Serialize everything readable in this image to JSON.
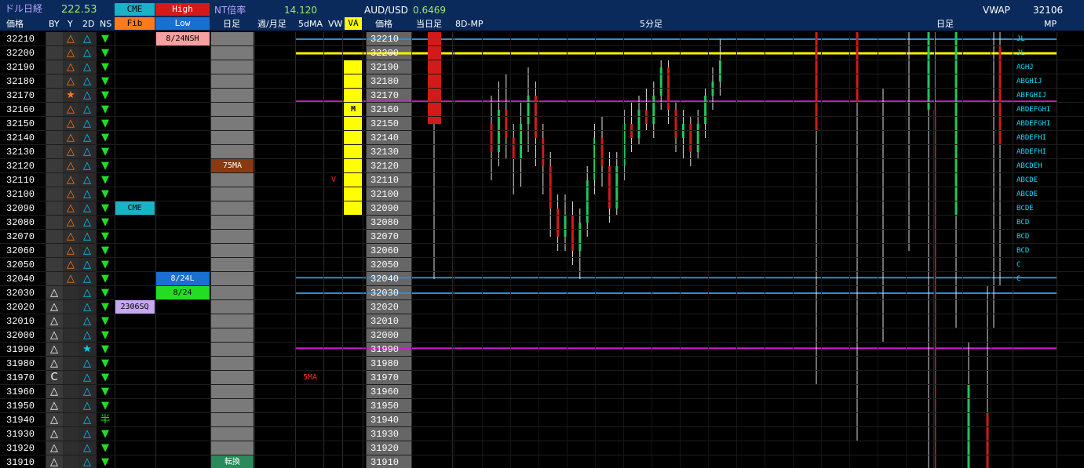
{
  "header": {
    "title": "ドル日経",
    "title_value": "222.53",
    "cme_label": "CME",
    "high_label": "High",
    "nt_label": "NT倍率",
    "nt_value": "14.120",
    "audusd_label": "AUD/USD",
    "audusd_value": "0.6469",
    "vwap_label": "VWAP",
    "vwap_value": "32106"
  },
  "columns": {
    "price": "価格",
    "by": "BY",
    "y": "Y",
    "twod": "2D",
    "ns": "NS",
    "fib": "Fib",
    "low": "Low",
    "daily": "日足",
    "weekmonth": "週/月足",
    "fivedma": "5dMA",
    "vw": "VW",
    "va": "VA",
    "price2": "価格",
    "today": "当日足",
    "eightdmp": "8D-MP",
    "fivemin": "5分足",
    "dailybar": "日足",
    "mp": "MP"
  },
  "prices": [
    "32210",
    "32200",
    "32190",
    "32180",
    "32170",
    "32160",
    "32150",
    "32140",
    "32130",
    "32120",
    "32110",
    "32100",
    "32090",
    "32080",
    "32070",
    "32060",
    "32050",
    "32040",
    "32030",
    "32020",
    "32010",
    "32000",
    "31990",
    "31980",
    "31970",
    "31960",
    "31950",
    "31940",
    "31930",
    "31920",
    "31910"
  ],
  "by_col": [
    "",
    "",
    "",
    "",
    "",
    "",
    "",
    "",
    "",
    "",
    "",
    "",
    "",
    "",
    "",
    "",
    "",
    "",
    "△",
    "△",
    "△",
    "△",
    "△",
    "△",
    "C",
    "△",
    "△",
    "△",
    "△",
    "△",
    "△"
  ],
  "y_col": [
    "△",
    "△",
    "△",
    "△",
    "★",
    "△",
    "△",
    "△",
    "△",
    "△",
    "△",
    "△",
    "△",
    "△",
    "△",
    "△",
    "△",
    "△",
    "",
    "",
    "",
    "",
    "",
    "",
    "",
    "",
    "",
    "",
    "",
    "",
    ""
  ],
  "twod_col": [
    "△",
    "△",
    "△",
    "△",
    "△",
    "△",
    "△",
    "△",
    "△",
    "△",
    "△",
    "△",
    "△",
    "△",
    "△",
    "△",
    "△",
    "△",
    "△",
    "△",
    "△",
    "△",
    "★",
    "△",
    "△",
    "△",
    "△",
    "△",
    "△",
    "△",
    "△"
  ],
  "ns_col": [
    "▼",
    "▼",
    "▼",
    "▼",
    "▼",
    "▼",
    "▼",
    "▼",
    "▼",
    "▼",
    "▼",
    "▼",
    "▼",
    "▼",
    "▼",
    "▼",
    "▼",
    "▼",
    "▼",
    "▼",
    "▼",
    "▼",
    "▼",
    "▼",
    "▼",
    "▼",
    "▼",
    "半",
    "▼",
    "▼",
    "▼"
  ],
  "labels": {
    "nsh": "8/24NSH",
    "cme": "CME",
    "sq": "2306SQ",
    "l824": "8/24L",
    "d824": "8/24",
    "ma75": "75MA",
    "ma5": "5MA",
    "v_marker": "V",
    "m_marker": "M",
    "tenkan": "転換"
  },
  "mp_letters": [
    "JL",
    "JL",
    "AGHJ",
    "ABGHIJ",
    "ABFGHIJ",
    "ABDEFGHI",
    "ABDEFGHI",
    "ABDEFHI",
    "ABDEFHI",
    "ABCDEH",
    "ABCDE",
    "ABCDE",
    "BCDE",
    "BCD",
    "BCD",
    "BCD",
    "C",
    "C",
    "",
    "",
    "",
    "",
    "",
    "",
    "",
    "",
    "",
    "",
    "",
    "",
    ""
  ],
  "colors": {
    "header_bg": "#0a2a5c",
    "up": "#22c55e",
    "down": "#d11a1a",
    "orange": "#ff7a1a",
    "cyan": "#00d0ff",
    "va": "#ffff00",
    "magenta": "#d01ad0",
    "blue_line": "#2a8fd6",
    "yellow_line": "#ffef00"
  },
  "chart_data": {
    "type": "candlestick",
    "price_axis": {
      "min": 31910,
      "max": 32210,
      "step": 10
    },
    "horizontal_levels": [
      {
        "price": 32210,
        "color": "blue"
      },
      {
        "price": 32200,
        "color": "yellow"
      },
      {
        "price": 32166,
        "color": "magenta"
      },
      {
        "price": 32041,
        "color": "blue"
      },
      {
        "price": 32030,
        "color": "blue"
      },
      {
        "price": 31991,
        "color": "magenta"
      }
    ],
    "value_area": {
      "high": 32200,
      "low": 32090
    },
    "today_bar": {
      "open": 32210,
      "close": 32150,
      "high": 32210,
      "low": 32040
    },
    "five_min": [
      {
        "o": 32150,
        "c": 32130,
        "h": 32170,
        "l": 32110
      },
      {
        "o": 32130,
        "c": 32160,
        "h": 32180,
        "l": 32120
      },
      {
        "o": 32160,
        "c": 32140,
        "h": 32185,
        "l": 32125
      },
      {
        "o": 32140,
        "c": 32125,
        "h": 32150,
        "l": 32100
      },
      {
        "o": 32125,
        "c": 32150,
        "h": 32165,
        "l": 32105
      },
      {
        "o": 32150,
        "c": 32170,
        "h": 32190,
        "l": 32130
      },
      {
        "o": 32170,
        "c": 32140,
        "h": 32180,
        "l": 32120
      },
      {
        "o": 32140,
        "c": 32120,
        "h": 32150,
        "l": 32100
      },
      {
        "o": 32120,
        "c": 32090,
        "h": 32130,
        "l": 32070
      },
      {
        "o": 32090,
        "c": 32070,
        "h": 32100,
        "l": 32060
      },
      {
        "o": 32070,
        "c": 32085,
        "h": 32100,
        "l": 32060
      },
      {
        "o": 32085,
        "c": 32060,
        "h": 32095,
        "l": 32050
      },
      {
        "o": 32060,
        "c": 32080,
        "h": 32090,
        "l": 32040
      },
      {
        "o": 32080,
        "c": 32110,
        "h": 32120,
        "l": 32070
      },
      {
        "o": 32110,
        "c": 32140,
        "h": 32150,
        "l": 32100
      },
      {
        "o": 32140,
        "c": 32120,
        "h": 32155,
        "l": 32105
      },
      {
        "o": 32120,
        "c": 32090,
        "h": 32130,
        "l": 32080
      },
      {
        "o": 32090,
        "c": 32120,
        "h": 32130,
        "l": 32085
      },
      {
        "o": 32120,
        "c": 32150,
        "h": 32160,
        "l": 32110
      },
      {
        "o": 32150,
        "c": 32140,
        "h": 32165,
        "l": 32130
      },
      {
        "o": 32140,
        "c": 32160,
        "h": 32170,
        "l": 32135
      },
      {
        "o": 32160,
        "c": 32150,
        "h": 32175,
        "l": 32145
      },
      {
        "o": 32150,
        "c": 32170,
        "h": 32180,
        "l": 32140
      },
      {
        "o": 32170,
        "c": 32190,
        "h": 32195,
        "l": 32160
      },
      {
        "o": 32190,
        "c": 32160,
        "h": 32195,
        "l": 32150
      },
      {
        "o": 32160,
        "c": 32140,
        "h": 32165,
        "l": 32130
      },
      {
        "o": 32140,
        "c": 32150,
        "h": 32160,
        "l": 32125
      },
      {
        "o": 32150,
        "c": 32130,
        "h": 32155,
        "l": 32120
      },
      {
        "o": 32130,
        "c": 32150,
        "h": 32160,
        "l": 32125
      },
      {
        "o": 32150,
        "c": 32170,
        "h": 32175,
        "l": 32140
      },
      {
        "o": 32170,
        "c": 32180,
        "h": 32190,
        "l": 32160
      },
      {
        "o": 32180,
        "c": 32195,
        "h": 32210,
        "l": 32170
      }
    ],
    "eight_day_mp_wicks": [
      {
        "high": 32210,
        "low": 31940
      },
      {
        "high": 32170,
        "low": 31995
      },
      {
        "high": 32210,
        "low": 32060
      },
      {
        "high": 32210,
        "low": 32050
      },
      {
        "high": 32210,
        "low": 32005
      }
    ],
    "daily_bars": [
      {
        "o": 32210,
        "c": 32170,
        "h": 32210,
        "l": 31930,
        "dir": "down"
      },
      {
        "o": 32210,
        "c": 32165,
        "h": 32210,
        "l": 31910,
        "dir": "up"
      },
      {
        "o": 32155,
        "c": 31910,
        "h": 32210,
        "l": 31910,
        "dir": "down"
      },
      {
        "o": 32210,
        "c": 32090,
        "h": 32210,
        "l": 32010,
        "dir": "up"
      },
      {
        "o": 32200,
        "c": 32140,
        "h": 32210,
        "l": 32040,
        "dir": "down"
      },
      {
        "o": 31960,
        "c": 31910,
        "h": 31990,
        "l": 31910,
        "dir": "up"
      },
      {
        "o": 31940,
        "c": 31910,
        "h": 32030,
        "l": 31910,
        "dir": "down"
      },
      {
        "o": 32210,
        "c": 32150,
        "h": 32210,
        "l": 31970,
        "dir": "down"
      }
    ]
  }
}
